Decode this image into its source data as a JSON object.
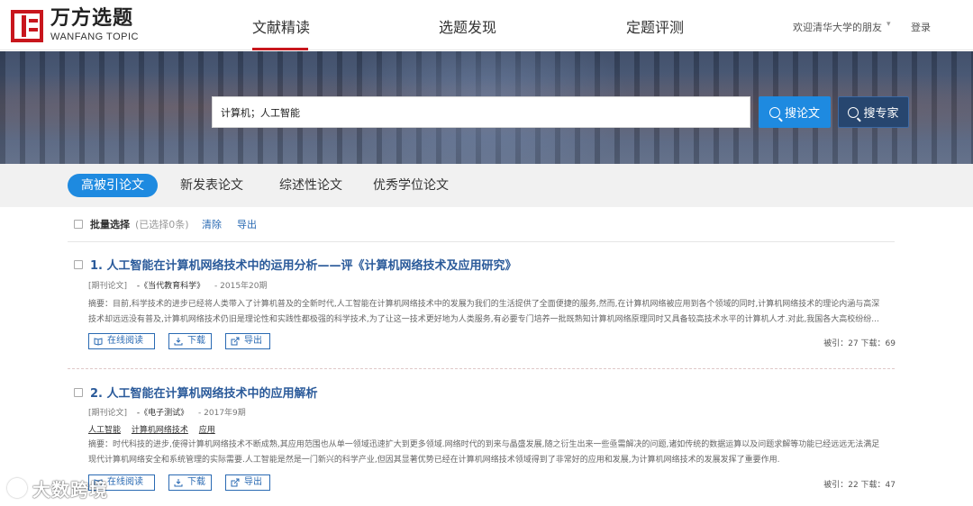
{
  "brand": {
    "name_cn": "万方选题",
    "name_en": "WANFANG TOPIC",
    "color": "#c8161d"
  },
  "nav": {
    "items": [
      {
        "label": "文献精读",
        "active": true
      },
      {
        "label": "选题发现",
        "active": false
      },
      {
        "label": "定题评测",
        "active": false
      }
    ],
    "welcome": "欢迎清华大学的朋友",
    "caret": "▾",
    "login": "登录"
  },
  "search": {
    "query": "计算机；人工智能",
    "btn_paper": "搜论文",
    "btn_expert": "搜专家",
    "btn_paper_color": "#1e8ae0",
    "btn_expert_color": "#27466f"
  },
  "tabs": [
    {
      "label": "高被引论文",
      "active": true
    },
    {
      "label": "新发表论文",
      "active": false
    },
    {
      "label": "综述性论文",
      "active": false
    },
    {
      "label": "优秀学位论文",
      "active": false
    }
  ],
  "batch": {
    "label": "批量选择",
    "count": "(已选择0条)",
    "clear": "清除",
    "export": "导出"
  },
  "results": [
    {
      "title": "1. 人工智能在计算机网络技术中的运用分析——评《计算机网络技术及应用研究》",
      "type": "[期刊论文]",
      "source": "-《当代教育科学》",
      "date": "- 2015年20期",
      "keywords": [],
      "abstract": [
        "摘要：目前,科学技术的进步已经将人类带入了计算机普及的全新时代,人工智能在计算机网络技术中的发展为我们的生活提供了全面便捷的服务,然而,在计算机网络被应用到各个领域的同时,计算机网络技术的理论内涵与高深",
        "技术却远远没有普及,计算机网络技术仍旧是理论性和实践性都极强的科学技术,为了让这一技术更好地为人类服务,有必要专门培养一批既熟知计算机网络原理同时又具备较高技术水平的计算机人才.对此,我国各大高校纷纷..."
      ],
      "actions": {
        "read": "在线阅读",
        "download": "下载",
        "export": "导出"
      },
      "stats": "被引：27  下载：69"
    },
    {
      "title": "2. 人工智能在计算机网络技术中的应用解析",
      "type": "[期刊论文]",
      "source": "-《电子测试》",
      "date": "- 2017年9期",
      "keywords": [
        "人工智能",
        "计算机网络技术",
        "应用"
      ],
      "abstract": [
        "摘要：时代科技的进步,使得计算机网络技术不断成熟,其应用范围也从单一领域迅速扩大到更多领域.网络时代的到来与晶盛发展,随之衍生出来一些亟需解决的问题,诸如传统的数据运算以及问题求解等功能已经远远无法满足",
        "现代计算机网络安全和系统管理的实际需要.人工智能是然是一门新兴的科学产业,但因其显著优势已经在计算机网络技术领域得到了非常好的应用和发展,为计算机网络技术的发展发挥了重要作用."
      ],
      "actions": {
        "read": "在线阅读",
        "download": "下载",
        "export": "导出"
      },
      "stats": "被引：22  下载：47"
    }
  ],
  "watermark": "大数跨境"
}
